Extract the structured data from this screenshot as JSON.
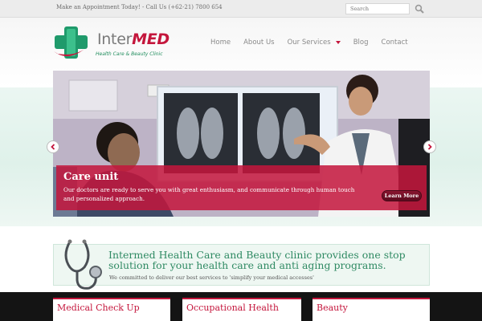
{
  "topbar": {
    "appointment_text": "Make an Appointment Today! - Call Us (+62-21) 7800 654",
    "search_placeholder": "Search"
  },
  "logo": {
    "name_part1": "Inter",
    "name_part2": "MED",
    "tagline": "Health Care & Beauty Clinic"
  },
  "nav": {
    "items": [
      {
        "label": "Home"
      },
      {
        "label": "About Us"
      },
      {
        "label": "Our Services"
      },
      {
        "label": "Blog"
      },
      {
        "label": "Contact"
      }
    ]
  },
  "slider": {
    "caption_title": "Care unit",
    "caption_text": "Our doctors are ready to serve you with great enthusiasm, and communicate through human touch and personalized approach.",
    "button_label": "Learn More"
  },
  "intro": {
    "headline": "Intermed Health Care and Beauty clinic provides one stop solution for your health care and anti aging programs.",
    "subtext": "We committed to deliver our best services to 'simplify your medical accesses'"
  },
  "services": [
    {
      "title": "Medical Check Up"
    },
    {
      "title": "Occupational Health"
    },
    {
      "title": "Beauty"
    }
  ],
  "colors": {
    "brand_red": "#c4163c",
    "brand_green": "#2f8a63"
  }
}
